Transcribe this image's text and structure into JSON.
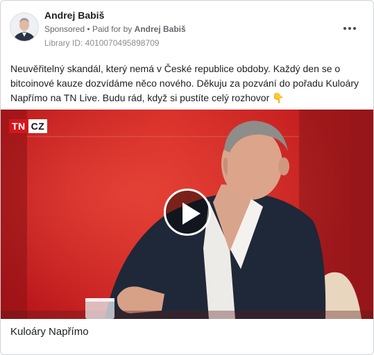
{
  "post": {
    "author_name": "Andrej Babiš",
    "sponsored_label": "Sponsored",
    "separator": "•",
    "paid_for_prefix": "Paid for by",
    "paid_for_name": "Andrej Babiš",
    "library_id": "Library ID: 4010070495898709",
    "more_icon": "more-horizontal-icon",
    "text": "Neuvěřitelný skandál, který nemá v České republice obdoby. Každý den se o bitcoinové kauze dozvídáme něco nového. Děkuju za pozvání do pořadu Kuloáry Napřímo na TN Live. Budu rád, když si pustíte celý rozhovor 👇"
  },
  "video": {
    "logo_left": "TN",
    "logo_right": "CZ",
    "play_icon": "play-icon",
    "accent_red": "#d6151c"
  },
  "footer": {
    "caption": "Kuloáry Napřímo"
  }
}
